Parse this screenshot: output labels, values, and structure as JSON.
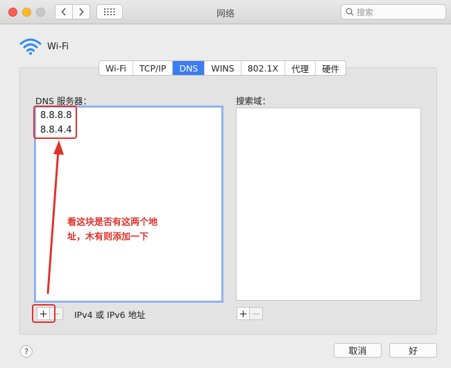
{
  "window": {
    "title": "网络"
  },
  "search": {
    "placeholder": "搜索"
  },
  "service": {
    "name": "Wi-Fi"
  },
  "tabs": [
    {
      "label": "Wi-Fi",
      "active": false
    },
    {
      "label": "TCP/IP",
      "active": false
    },
    {
      "label": "DNS",
      "active": true
    },
    {
      "label": "WINS",
      "active": false
    },
    {
      "label": "802.1X",
      "active": false
    },
    {
      "label": "代理",
      "active": false
    },
    {
      "label": "硬件",
      "active": false
    }
  ],
  "dns": {
    "label": "DNS 服务器：",
    "servers": [
      "8.8.8.8",
      "8.8.4.4"
    ],
    "add_label": "+",
    "remove_label": "−",
    "hint": "IPv4 或 IPv6 地址"
  },
  "search_domains": {
    "label": "搜索域：",
    "add_label": "+",
    "remove_label": "−"
  },
  "annotation": {
    "text": "看这块是否有这两个地址，木有则添加一下",
    "color": "#e0312a"
  },
  "footer": {
    "help_label": "?",
    "cancel_label": "取消",
    "ok_label": "好"
  },
  "colors": {
    "accent": "#3a7cf3",
    "annotation": "#e0312a"
  }
}
